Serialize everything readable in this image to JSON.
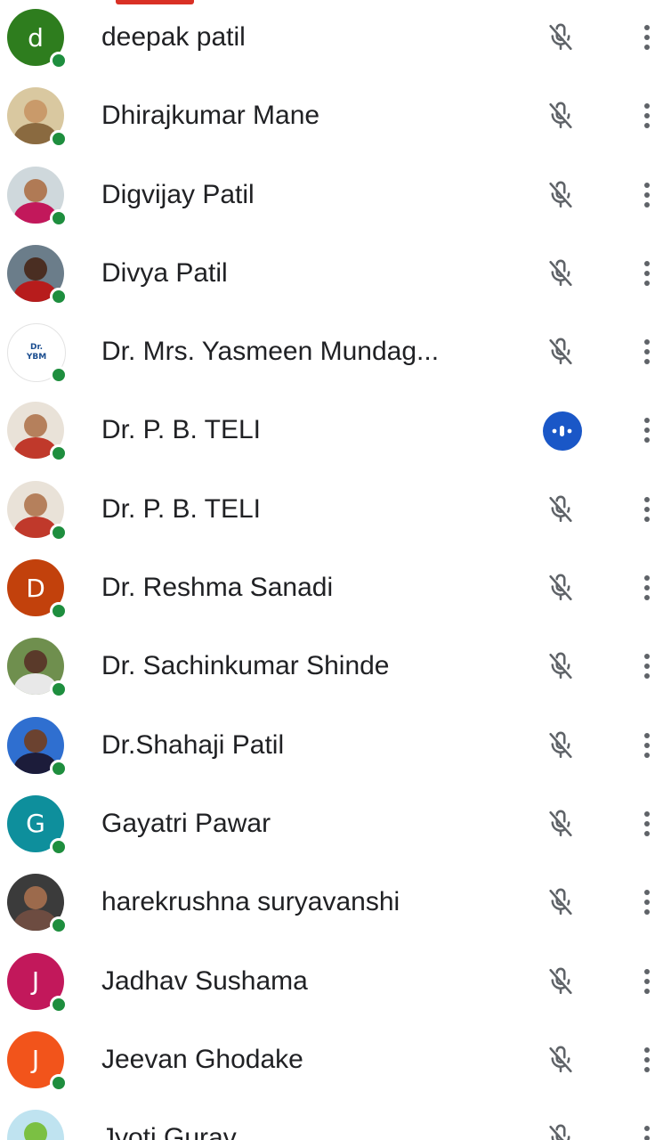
{
  "colors": {
    "presence": "#1e8e3e",
    "speaking": "#1a57c7",
    "name_text": "#202124",
    "icon_gray": "#5f6368",
    "tab_indicator": "#d93025"
  },
  "participants": [
    {
      "name": "deepak patil",
      "avatar_type": "initial",
      "initial": "d",
      "avatar_color": "#2e7d1e",
      "audio": "muted"
    },
    {
      "name": "Dhirajkumar Mane",
      "avatar_type": "photo",
      "audio": "muted"
    },
    {
      "name": "Digvijay Patil",
      "avatar_type": "photo",
      "audio": "muted"
    },
    {
      "name": "Divya Patil",
      "avatar_type": "photo",
      "audio": "muted"
    },
    {
      "name": "Dr. Mrs. Yasmeen Mundag...",
      "avatar_type": "text",
      "avatar_text_line1": "Dr.",
      "avatar_text_line2": "YBM",
      "audio": "muted"
    },
    {
      "name": "Dr. P. B. TELI",
      "avatar_type": "photo",
      "audio": "speaking"
    },
    {
      "name": "Dr. P. B. TELI",
      "avatar_type": "photo",
      "audio": "muted"
    },
    {
      "name": "Dr. Reshma Sanadi",
      "avatar_type": "initial",
      "initial": "D",
      "avatar_color": "#c2410c",
      "audio": "muted"
    },
    {
      "name": "Dr. Sachinkumar Shinde",
      "avatar_type": "photo",
      "audio": "muted"
    },
    {
      "name": "Dr.Shahaji Patil",
      "avatar_type": "photo",
      "audio": "muted"
    },
    {
      "name": "Gayatri Pawar",
      "avatar_type": "initial",
      "initial": "G",
      "avatar_color": "#0e8f9c",
      "audio": "muted"
    },
    {
      "name": "harekrushna suryavanshi",
      "avatar_type": "photo",
      "audio": "muted"
    },
    {
      "name": "Jadhav Sushama",
      "avatar_type": "initial",
      "initial": "J",
      "avatar_color": "#c2185b",
      "audio": "muted"
    },
    {
      "name": "Jeevan Ghodake",
      "avatar_type": "initial",
      "initial": "J",
      "avatar_color": "#f2541b",
      "audio": "muted"
    },
    {
      "name": "Jyoti Gurav",
      "avatar_type": "photo",
      "audio": "muted"
    }
  ],
  "icons": {
    "muted": "mic-off-icon",
    "speaking": "speaking-indicator-icon",
    "more": "more-vert-icon",
    "presence": "online-dot"
  }
}
